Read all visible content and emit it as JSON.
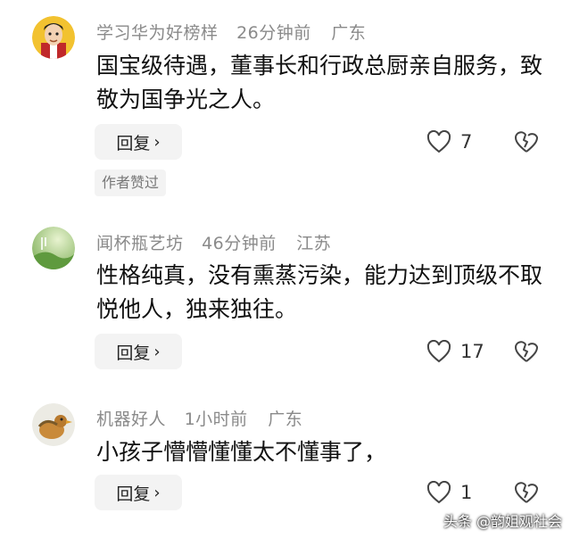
{
  "comments": [
    {
      "username": "学习华为好榜样",
      "time": "26分钟前",
      "location": "广东",
      "text": "国宝级待遇，董事长和行政总厨亲自服务，致敬为国争光之人。",
      "reply_label": "回复",
      "likes": "7",
      "author_badge": "作者赞过",
      "avatar_icon": "cartoon-man-avatar-icon"
    },
    {
      "username": "闻杯瓶艺坊",
      "time": "46分钟前",
      "location": "江苏",
      "text": "性格纯真，没有熏蒸污染，能力达到顶级不取悦他人，独来独往。",
      "reply_label": "回复",
      "likes": "17",
      "avatar_icon": "green-landscape-avatar-icon"
    },
    {
      "username": "机器好人",
      "time": "1小时前",
      "location": "广东",
      "text": "小孩子懵懵懂懂太不懂事了，",
      "reply_label": "回复",
      "likes": "1",
      "avatar_icon": "bird-avatar-icon"
    }
  ],
  "watermark": "头条 @韵姐观社会",
  "colors": {
    "meta_gray": "#8a8a8a",
    "button_bg": "#f3f3f3",
    "text": "#111111"
  }
}
